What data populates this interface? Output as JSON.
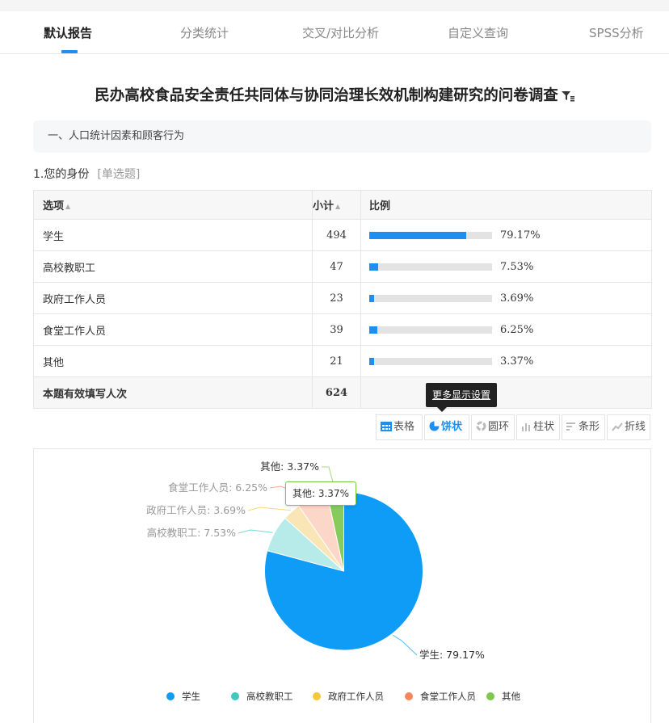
{
  "tabs": [
    {
      "label": "默认报告",
      "active": true
    },
    {
      "label": "分类统计",
      "active": false
    },
    {
      "label": "交叉/对比分析",
      "active": false
    },
    {
      "label": "自定义查询",
      "active": false
    },
    {
      "label": "SPSS分析",
      "active": false
    }
  ],
  "title": "民办高校食品安全责任共同体与协同治理长效机制构建研究的问卷调查",
  "section": "一、人口统计因素和顾客行为",
  "question": {
    "title": "1.您的身份",
    "type": "[单选题]"
  },
  "table": {
    "headers": {
      "option": "选项",
      "count": "小计",
      "ratio": "比例"
    },
    "rows": [
      {
        "option": "学生",
        "count": "494",
        "pct": "79.17%",
        "fraction": 0.7917
      },
      {
        "option": "高校教职工",
        "count": "47",
        "pct": "7.53%",
        "fraction": 0.0753
      },
      {
        "option": "政府工作人员",
        "count": "23",
        "pct": "3.69%",
        "fraction": 0.0369
      },
      {
        "option": "食堂工作人员",
        "count": "39",
        "pct": "6.25%",
        "fraction": 0.0625
      },
      {
        "option": "其他",
        "count": "21",
        "pct": "3.37%",
        "fraction": 0.0337
      }
    ],
    "total": {
      "label": "本题有效填写人次",
      "count": "624"
    }
  },
  "more_settings": "更多显示设置",
  "chart_types": [
    {
      "label": "表格",
      "icon": "table-icon",
      "active": false
    },
    {
      "label": "饼状",
      "icon": "pie-icon",
      "active": true
    },
    {
      "label": "圆环",
      "icon": "ring-icon",
      "active": false
    },
    {
      "label": "柱状",
      "icon": "column-icon",
      "active": false
    },
    {
      "label": "条形",
      "icon": "bar-icon",
      "active": false
    },
    {
      "label": "折线",
      "icon": "line-icon",
      "active": false
    }
  ],
  "pie_tooltip": "其他:  3.37%",
  "chart_data": {
    "type": "pie",
    "categories": [
      "学生",
      "高校教职工",
      "政府工作人员",
      "食堂工作人员",
      "其他"
    ],
    "values": [
      79.17,
      7.53,
      3.69,
      6.25,
      3.37
    ],
    "labels": [
      "学生: 79.17%",
      "高校教职工: 7.53%",
      "政府工作人员: 3.69%",
      "食堂工作人员: 6.25%",
      "其他: 3.37%"
    ],
    "colors": [
      "#0e9cf6",
      "#b6ebea",
      "#f9e5b6",
      "#fcd6c7",
      "#86cb5b"
    ],
    "legend_colors": [
      "#0e9cf6",
      "#3ec9c0",
      "#f8c83b",
      "#f7875b",
      "#7cc94c"
    ],
    "legend": "bottom-center"
  }
}
